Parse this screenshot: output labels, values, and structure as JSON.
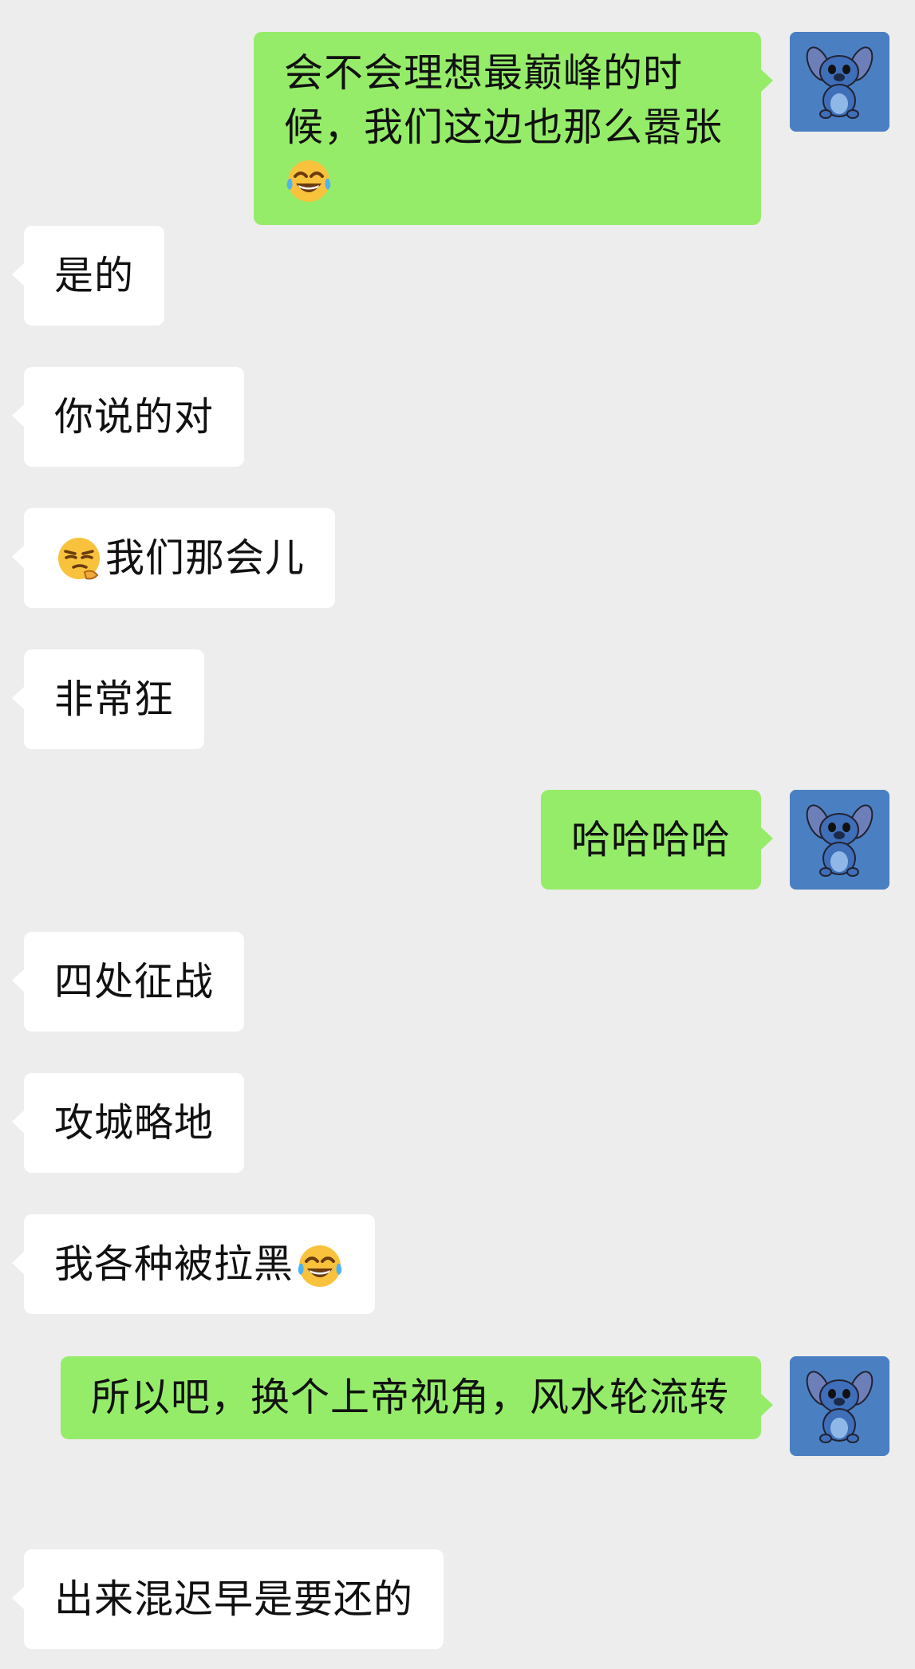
{
  "chat": {
    "messages": [
      {
        "side": "out",
        "text": "会不会理想最巅峰的时候，我们这边也那么嚣张",
        "emoji": "tears-of-joy-emoji"
      },
      {
        "side": "in",
        "text": "是的"
      },
      {
        "side": "in",
        "text": "你说的对"
      },
      {
        "side": "in",
        "text": "我们那会儿",
        "emoji_lead": "thinking-smirk-emoji"
      },
      {
        "side": "in",
        "text": "非常狂"
      },
      {
        "side": "out",
        "text": "哈哈哈哈"
      },
      {
        "side": "in",
        "text": "四处征战"
      },
      {
        "side": "in",
        "text": "攻城略地"
      },
      {
        "side": "in",
        "text": "我各种被拉黑",
        "emoji": "tears-of-joy-emoji"
      },
      {
        "side": "out",
        "text": "所以吧，换个上帝视角，风水轮流转"
      },
      {
        "side": "in",
        "text": "出来混迟早是要还的"
      }
    ]
  },
  "avatar": {
    "icon": "stitch-avatar-icon",
    "color": "#4a80c2"
  },
  "colors": {
    "background": "#ededed",
    "incoming_bubble": "#ffffff",
    "outgoing_bubble": "#95ec69"
  }
}
